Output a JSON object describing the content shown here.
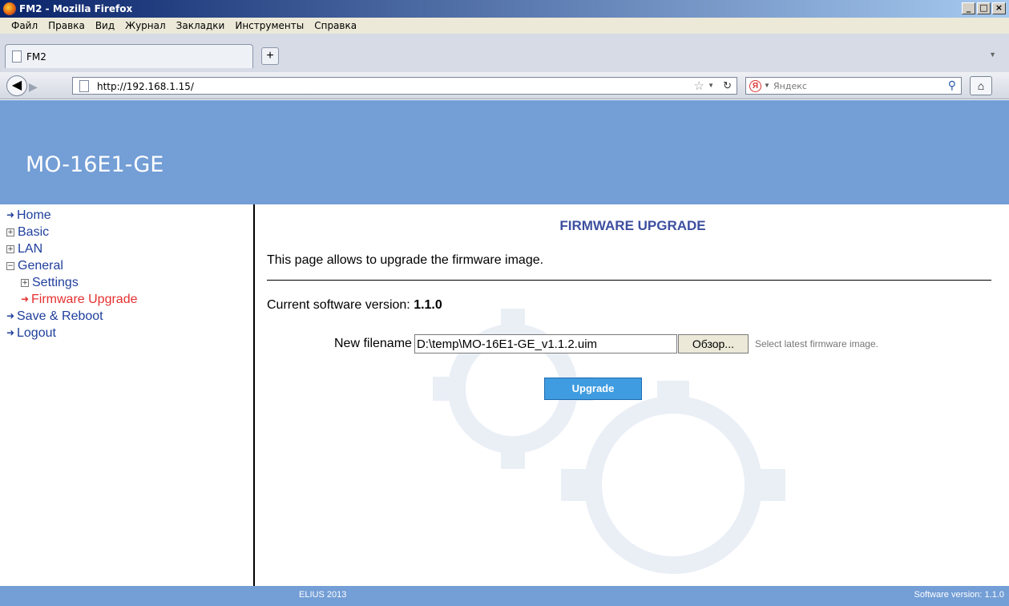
{
  "window": {
    "title": "FM2 - Mozilla Firefox"
  },
  "menubar": {
    "items": [
      "Файл",
      "Правка",
      "Вид",
      "Журнал",
      "Закладки",
      "Инструменты",
      "Справка"
    ]
  },
  "tabs": {
    "active_label": "FM2",
    "new_tab": "+"
  },
  "navbar": {
    "url": "http://192.168.1.15/",
    "search_placeholder": "Яндекс",
    "search_engine_badge": "Я"
  },
  "header": {
    "device_name": "MO-16E1-GE"
  },
  "nav": {
    "items": [
      {
        "label": "Home"
      },
      {
        "label": "Basic"
      },
      {
        "label": "LAN"
      },
      {
        "label": "General"
      },
      {
        "label": "Settings"
      },
      {
        "label": "Firmware Upgrade"
      },
      {
        "label": "Save & Reboot"
      },
      {
        "label": "Logout"
      }
    ]
  },
  "main": {
    "title": "FIRMWARE UPGRADE",
    "description": "This page allows to upgrade the firmware image.",
    "version_label": "Current software version:",
    "version_value": "1.1.0",
    "file_label": "New filename",
    "file_value": "D:\\temp\\MO-16E1-GE_v1.1.2.uim",
    "browse_label": "Обзор...",
    "hint": "Select latest firmware image.",
    "upgrade_label": "Upgrade"
  },
  "footer": {
    "copyright": "ELIUS 2013",
    "software_version": "Software version: 1.1.0"
  },
  "colors": {
    "header_bg": "#739ed6",
    "title_color": "#3d4fa0",
    "link_color": "#1f3f9c",
    "active_link": "#e53030",
    "button_bg": "#3f9ce0"
  }
}
